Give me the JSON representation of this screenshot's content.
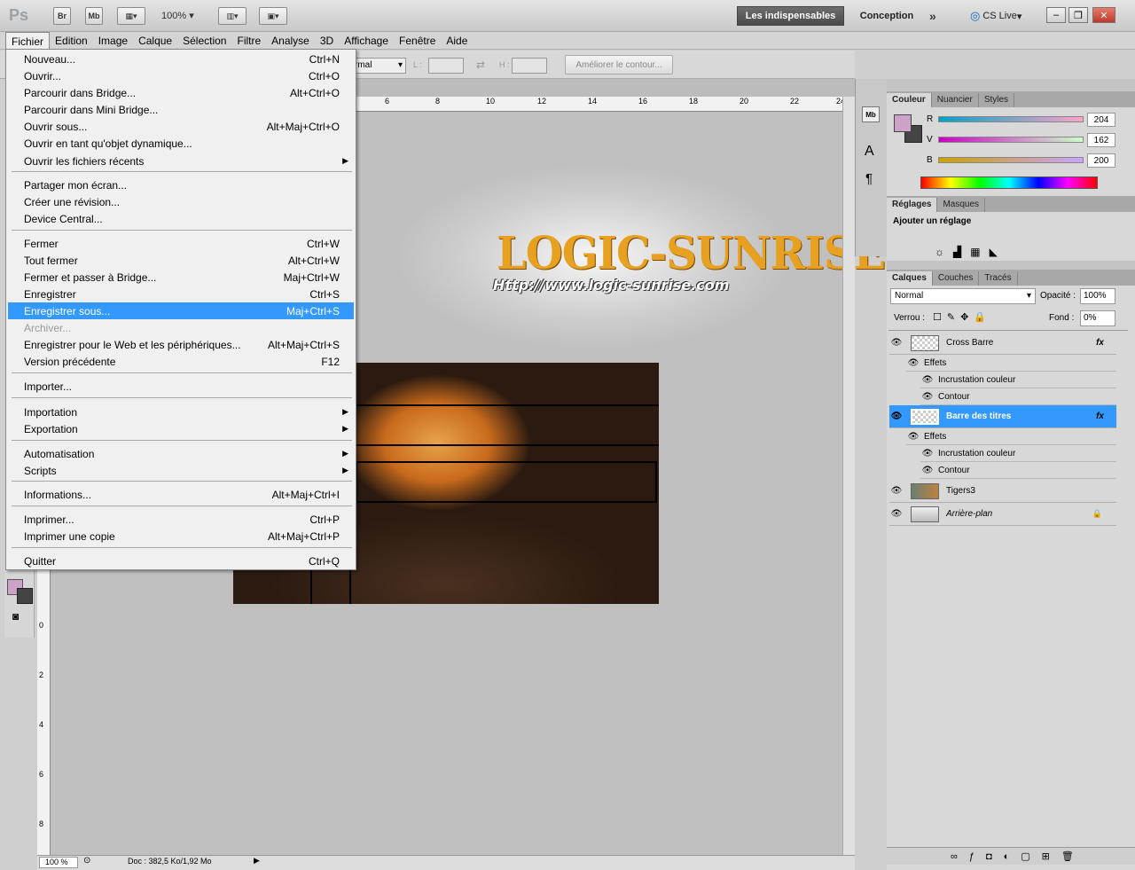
{
  "app": {
    "logo": "Ps",
    "bridge": "Br",
    "mini_bridge": "Mb",
    "zoom": "100%"
  },
  "workspaces": {
    "active": "Les indispensables",
    "other": "Conception",
    "more": "»",
    "cslive": "CS Live"
  },
  "window_buttons": [
    "–",
    "❐",
    "✕"
  ],
  "menubar": [
    "Fichier",
    "Edition",
    "Image",
    "Calque",
    "Sélection",
    "Filtre",
    "Analyse",
    "3D",
    "Affichage",
    "Fenêtre",
    "Aide"
  ],
  "options": {
    "mode": "rmal",
    "w_label": "L :",
    "h_label": "H :",
    "refine": "Améliorer le contour..."
  },
  "file_menu": [
    {
      "label": "Nouveau...",
      "shortcut": "Ctrl+N"
    },
    {
      "label": "Ouvrir...",
      "shortcut": "Ctrl+O"
    },
    {
      "label": "Parcourir dans Bridge...",
      "shortcut": "Alt+Ctrl+O"
    },
    {
      "label": "Parcourir dans Mini Bridge...",
      "shortcut": ""
    },
    {
      "label": "Ouvrir sous...",
      "shortcut": "Alt+Maj+Ctrl+O"
    },
    {
      "label": "Ouvrir en tant qu'objet dynamique...",
      "shortcut": ""
    },
    {
      "label": "Ouvrir les fichiers récents",
      "shortcut": "",
      "submenu": true
    },
    {
      "label": "Partager mon écran...",
      "shortcut": ""
    },
    {
      "label": "Créer une révision...",
      "shortcut": ""
    },
    {
      "label": "Device Central...",
      "shortcut": ""
    },
    {
      "label": "Fermer",
      "shortcut": "Ctrl+W"
    },
    {
      "label": "Tout fermer",
      "shortcut": "Alt+Ctrl+W"
    },
    {
      "label": "Fermer et passer à Bridge...",
      "shortcut": "Maj+Ctrl+W"
    },
    {
      "label": "Enregistrer",
      "shortcut": "Ctrl+S"
    },
    {
      "label": "Enregistrer sous...",
      "shortcut": "Maj+Ctrl+S",
      "highlighted": true
    },
    {
      "label": "Archiver...",
      "shortcut": "",
      "disabled": true
    },
    {
      "label": "Enregistrer pour le Web et les périphériques...",
      "shortcut": "Alt+Maj+Ctrl+S"
    },
    {
      "label": "Version précédente",
      "shortcut": "F12"
    },
    {
      "label": "Importer...",
      "shortcut": ""
    },
    {
      "label": "Importation",
      "shortcut": "",
      "submenu": true
    },
    {
      "label": "Exportation",
      "shortcut": "",
      "submenu": true
    },
    {
      "label": "Automatisation",
      "shortcut": "",
      "submenu": true
    },
    {
      "label": "Scripts",
      "shortcut": "",
      "submenu": true
    },
    {
      "label": "Informations...",
      "shortcut": "Alt+Maj+Ctrl+I"
    },
    {
      "label": "Imprimer...",
      "shortcut": "Ctrl+P"
    },
    {
      "label": "Imprimer une copie",
      "shortcut": "Alt+Maj+Ctrl+P"
    },
    {
      "label": "Quitter",
      "shortcut": "Ctrl+Q"
    }
  ],
  "ruler_top": [
    "6",
    "8",
    "10",
    "12",
    "14",
    "16",
    "18",
    "20",
    "22",
    "24"
  ],
  "ruler_left": [
    "0",
    "2",
    "4",
    "6",
    "8"
  ],
  "artwork": {
    "logo": "LOGIC-SUNRISE",
    "url": "Http://www.logic-sunrise.com"
  },
  "status": {
    "zoom": "100 %",
    "doc": "Doc : 382,5 Ko/1,92 Mo"
  },
  "color_panel": {
    "tabs": [
      "Couleur",
      "Nuancier",
      "Styles"
    ],
    "r": {
      "label": "R",
      "value": "204"
    },
    "v": {
      "label": "V",
      "value": "162"
    },
    "b": {
      "label": "B",
      "value": "200"
    },
    "fg": "#cca2c8"
  },
  "adjust_panel": {
    "tabs": [
      "Réglages",
      "Masques"
    ],
    "title": "Ajouter un réglage"
  },
  "layers_panel": {
    "tabs": [
      "Calques",
      "Couches",
      "Tracés"
    ],
    "blend": "Normal",
    "opacity_label": "Opacité :",
    "opacity": "100%",
    "lock_label": "Verrou :",
    "fill_label": "Fond :",
    "fill": "0%",
    "fx": "fx",
    "layers": [
      {
        "name": "Cross Barre",
        "effects_label": "Effets",
        "effects": [
          "Incrustation couleur",
          "Contour"
        ]
      },
      {
        "name": "Barre des titres",
        "selected": true,
        "effects_label": "Effets",
        "effects": [
          "Incrustation couleur",
          "Contour"
        ]
      },
      {
        "name": "Tigers3"
      },
      {
        "name": "Arrière-plan"
      }
    ]
  }
}
